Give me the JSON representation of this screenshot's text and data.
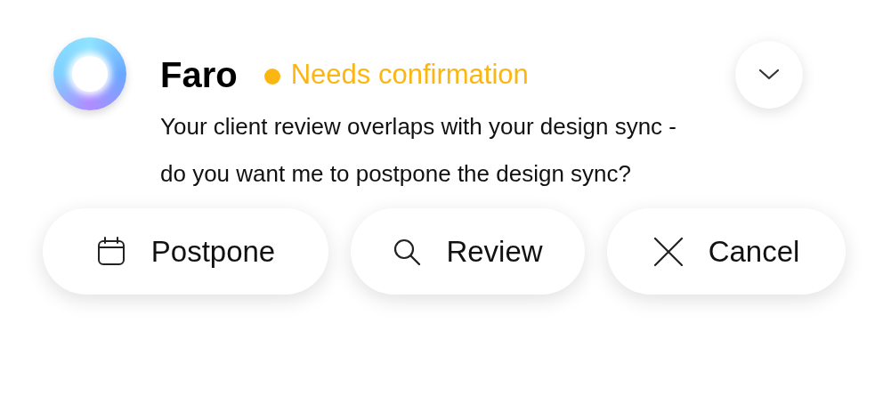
{
  "notification": {
    "sender": "Faro",
    "status": {
      "kind": "needs_confirmation",
      "label": "Needs confirmation"
    },
    "message": "Your client review overlaps with your design sync - do you want me to postpone the design sync?"
  },
  "actions": [
    {
      "kind": "postpone",
      "label": "Postpone"
    },
    {
      "kind": "review",
      "label": "Review"
    },
    {
      "kind": "cancel",
      "label": "Cancel"
    }
  ]
}
